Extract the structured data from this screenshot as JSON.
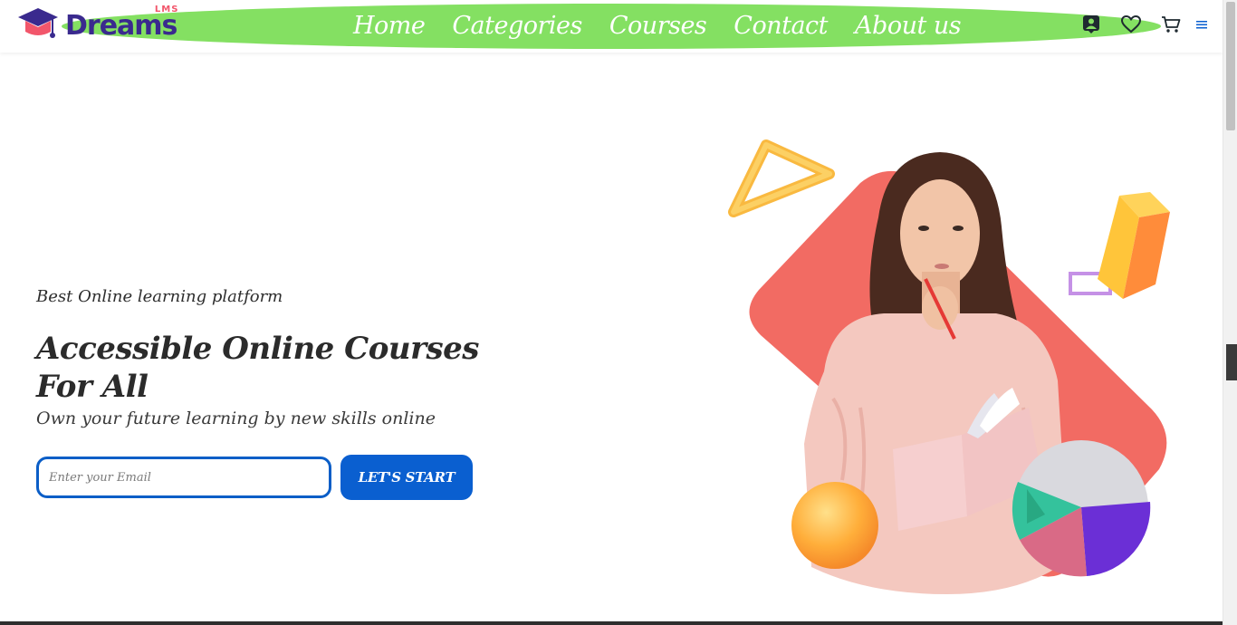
{
  "header": {
    "logo_text": "Dreams",
    "logo_badge": "LMS",
    "nav": [
      {
        "label": "Home"
      },
      {
        "label": "Categories"
      },
      {
        "label": "Courses"
      },
      {
        "label": "Contact"
      },
      {
        "label": "About us"
      }
    ],
    "icons": [
      "user-icon",
      "heart-icon",
      "cart-icon",
      "menu-icon"
    ],
    "nav_bg_color": "#84e062"
  },
  "hero": {
    "eyebrow": "Best Online learning platform",
    "headline": "Accessible Online Courses For All",
    "subline": "Own your future learning by new skills online",
    "email_placeholder": "Enter your Email",
    "cta_label": "LET'S START",
    "accent_color": "#0a5fd0"
  }
}
